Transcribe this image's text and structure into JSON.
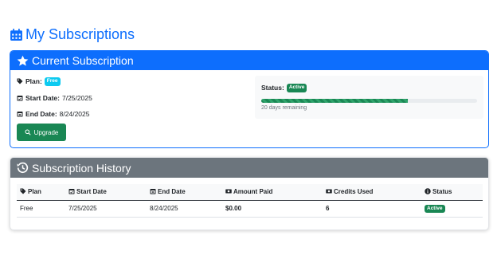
{
  "page": {
    "title": "My Subscriptions",
    "title_icon": "calendar-icon",
    "accent": "#0d6efd"
  },
  "current": {
    "header": "Current Subscription",
    "header_icon": "star-icon",
    "plan_label": "Plan:",
    "plan_value": "Free",
    "start_label": "Start Date:",
    "start_value": "7/25/2025",
    "end_label": "End Date:",
    "end_value": "8/24/2025",
    "upgrade_label": "Upgrade",
    "status_label": "Status:",
    "status_value": "Active",
    "progress": 0.68,
    "remaining_text": "20 days remaining"
  },
  "history": {
    "header": "Subscription History",
    "header_icon": "history-icon",
    "columns": [
      "Plan",
      "Start Date",
      "End Date",
      "Amount Paid",
      "Credits Used",
      "Status"
    ],
    "rows": [
      {
        "plan": "Free",
        "start": "7/25/2025",
        "end": "8/24/2025",
        "amount": "$0.00",
        "credits": "6",
        "status": "Active"
      }
    ]
  }
}
